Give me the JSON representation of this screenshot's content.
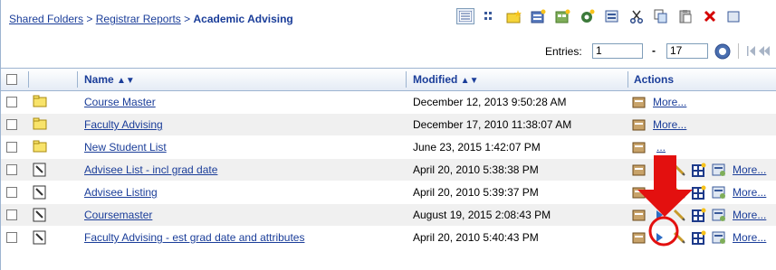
{
  "breadcrumb": {
    "items": [
      "Shared Folders",
      "Registrar Reports"
    ],
    "separator": ">",
    "current": "Academic Advising"
  },
  "toolbar": {
    "icons": [
      "list-view-icon",
      "thumbnail-view-icon",
      "new-folder-icon",
      "new-report-icon",
      "new-dashboard-icon",
      "new-agent-icon",
      "properties-icon",
      "cut-icon",
      "copy-icon",
      "paste-icon",
      "delete-icon",
      "more-icon"
    ]
  },
  "pagination": {
    "label": "Entries:",
    "from": "1",
    "dash": "-",
    "to": "17"
  },
  "table": {
    "headers": {
      "name": "Name",
      "modified": "Modified",
      "actions": "Actions"
    },
    "rows": [
      {
        "type": "folder",
        "name": "Course Master",
        "modified": "December 12, 2013 9:50:28 AM",
        "more": "More..."
      },
      {
        "type": "folder",
        "name": "Faculty Advising",
        "modified": "December 17, 2010 11:38:07 AM",
        "more": "More..."
      },
      {
        "type": "folder",
        "name": "New Student List",
        "modified": "June 23, 2015 1:42:07 PM",
        "more": "..."
      },
      {
        "type": "report",
        "name": "Advisee List - incl grad date",
        "modified": "April 20, 2010 5:38:38 PM",
        "more": "More..."
      },
      {
        "type": "report",
        "name": "Advisee Listing",
        "modified": "April 20, 2010 5:39:37 PM",
        "more": "More..."
      },
      {
        "type": "report",
        "name": "Coursemaster",
        "modified": "August 19, 2015 2:08:43 PM",
        "more": "More..."
      },
      {
        "type": "report",
        "name": "Faculty Advising - est grad date and attributes",
        "modified": "April 20, 2010 5:40:43 PM",
        "more": "More..."
      }
    ]
  },
  "colors": {
    "link": "#1a3d99",
    "annotation": "#e3100f",
    "row_alt": "#f0f0f0"
  }
}
